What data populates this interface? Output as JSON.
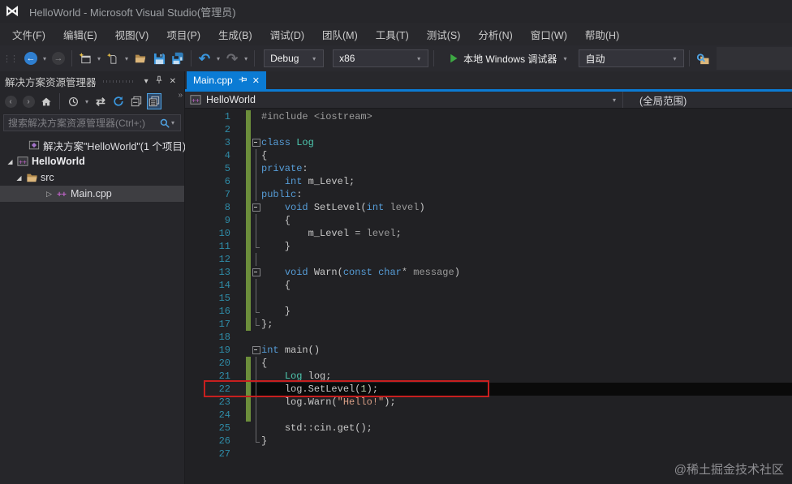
{
  "window": {
    "title": "HelloWorld - Microsoft Visual Studio(管理员)"
  },
  "menubar": {
    "items": [
      "文件(F)",
      "编辑(E)",
      "视图(V)",
      "项目(P)",
      "生成(B)",
      "调试(D)",
      "团队(M)",
      "工具(T)",
      "测试(S)",
      "分析(N)",
      "窗口(W)",
      "帮助(H)"
    ]
  },
  "toolbar": {
    "debug_combo": "Debug",
    "platform_combo": "x86",
    "run_button": "本地 Windows 调试器",
    "auto_combo": "自动"
  },
  "sidebar": {
    "title": "解决方案资源管理器",
    "search_placeholder": "搜索解决方案资源管理器(Ctrl+;)",
    "tree": [
      {
        "label": "解决方案\"HelloWorld\"(1 个项目)",
        "icon": "solution",
        "expander": "",
        "indent": 20,
        "bold": false,
        "selected": false
      },
      {
        "label": "HelloWorld",
        "icon": "cpp-project",
        "expander": "expanded",
        "indent": 6,
        "bold": true,
        "selected": false
      },
      {
        "label": "src",
        "icon": "folder-open",
        "expander": "expanded",
        "indent": 17,
        "bold": false,
        "selected": false
      },
      {
        "label": "Main.cpp",
        "icon": "cpp-file",
        "expander": "collapsed",
        "indent": 54,
        "bold": false,
        "selected": true
      }
    ]
  },
  "editor": {
    "tab": "Main.cpp",
    "navbar_project": "HelloWorld",
    "navbar_scope": "(全局范围)",
    "current_line": 22,
    "annotation_line": 22,
    "lines": [
      {
        "n": 1,
        "fold": "",
        "changed": true,
        "tokens": [
          [
            "pp",
            "#include "
          ],
          [
            "pp",
            "<iostream>"
          ]
        ]
      },
      {
        "n": 2,
        "fold": "",
        "changed": true,
        "tokens": []
      },
      {
        "n": 3,
        "fold": "start",
        "changed": true,
        "tokens": [
          [
            "kw",
            "class"
          ],
          [
            "pl",
            " "
          ],
          [
            "ty",
            "Log"
          ]
        ]
      },
      {
        "n": 4,
        "fold": "mid",
        "changed": true,
        "tokens": [
          [
            "pl",
            "{"
          ]
        ]
      },
      {
        "n": 5,
        "fold": "mid",
        "changed": true,
        "tokens": [
          [
            "kw",
            "private"
          ],
          [
            "pl",
            ":"
          ]
        ]
      },
      {
        "n": 6,
        "fold": "mid",
        "changed": true,
        "tokens": [
          [
            "pl",
            "    "
          ],
          [
            "kw",
            "int"
          ],
          [
            "pl",
            " "
          ],
          [
            "id",
            "m_Level"
          ],
          [
            "pl",
            ";"
          ]
        ]
      },
      {
        "n": 7,
        "fold": "mid",
        "changed": true,
        "tokens": [
          [
            "kw",
            "public"
          ],
          [
            "pl",
            ":"
          ]
        ]
      },
      {
        "n": 8,
        "fold": "start",
        "changed": true,
        "tokens": [
          [
            "pl",
            "    "
          ],
          [
            "kw",
            "void"
          ],
          [
            "pl",
            " "
          ],
          [
            "id",
            "SetLevel"
          ],
          [
            "pl",
            "("
          ],
          [
            "kw",
            "int"
          ],
          [
            "pl",
            " "
          ],
          [
            "pr",
            "level"
          ],
          [
            "pl",
            ")"
          ]
        ]
      },
      {
        "n": 9,
        "fold": "mid",
        "changed": true,
        "tokens": [
          [
            "pl",
            "    {"
          ]
        ]
      },
      {
        "n": 10,
        "fold": "mid",
        "changed": true,
        "tokens": [
          [
            "pl",
            "        "
          ],
          [
            "id",
            "m_Level"
          ],
          [
            "pl",
            " "
          ],
          [
            "op",
            "="
          ],
          [
            "pl",
            " "
          ],
          [
            "pr",
            "level"
          ],
          [
            "pl",
            ";"
          ]
        ]
      },
      {
        "n": 11,
        "fold": "end",
        "changed": true,
        "tokens": [
          [
            "pl",
            "    }"
          ]
        ]
      },
      {
        "n": 12,
        "fold": "mid",
        "changed": true,
        "tokens": []
      },
      {
        "n": 13,
        "fold": "start",
        "changed": true,
        "tokens": [
          [
            "pl",
            "    "
          ],
          [
            "kw",
            "void"
          ],
          [
            "pl",
            " "
          ],
          [
            "id",
            "Warn"
          ],
          [
            "pl",
            "("
          ],
          [
            "kw",
            "const"
          ],
          [
            "pl",
            " "
          ],
          [
            "kw",
            "char"
          ],
          [
            "op",
            "*"
          ],
          [
            "pl",
            " "
          ],
          [
            "pr",
            "message"
          ],
          [
            "pl",
            ")"
          ]
        ]
      },
      {
        "n": 14,
        "fold": "mid",
        "changed": true,
        "tokens": [
          [
            "pl",
            "    {"
          ]
        ]
      },
      {
        "n": 15,
        "fold": "mid",
        "changed": true,
        "tokens": []
      },
      {
        "n": 16,
        "fold": "end",
        "changed": true,
        "tokens": [
          [
            "pl",
            "    }"
          ]
        ]
      },
      {
        "n": 17,
        "fold": "end",
        "changed": true,
        "tokens": [
          [
            "pl",
            "};"
          ]
        ]
      },
      {
        "n": 18,
        "fold": "",
        "changed": false,
        "tokens": []
      },
      {
        "n": 19,
        "fold": "start",
        "changed": false,
        "tokens": [
          [
            "kw",
            "int"
          ],
          [
            "pl",
            " "
          ],
          [
            "id",
            "main"
          ],
          [
            "pl",
            "()"
          ]
        ]
      },
      {
        "n": 20,
        "fold": "mid",
        "changed": true,
        "tokens": [
          [
            "pl",
            "{"
          ]
        ]
      },
      {
        "n": 21,
        "fold": "mid",
        "changed": true,
        "tokens": [
          [
            "pl",
            "    "
          ],
          [
            "ty",
            "Log"
          ],
          [
            "pl",
            " "
          ],
          [
            "id",
            "log"
          ],
          [
            "pl",
            ";"
          ]
        ]
      },
      {
        "n": 22,
        "fold": "mid",
        "changed": true,
        "tokens": [
          [
            "pl",
            "    "
          ],
          [
            "id",
            "log"
          ],
          [
            "pl",
            "."
          ],
          [
            "id",
            "SetLevel"
          ],
          [
            "pl",
            "("
          ],
          [
            "num",
            "1"
          ],
          [
            "pl",
            ");"
          ]
        ]
      },
      {
        "n": 23,
        "fold": "mid",
        "changed": true,
        "tokens": [
          [
            "pl",
            "    "
          ],
          [
            "id",
            "log"
          ],
          [
            "pl",
            "."
          ],
          [
            "id",
            "Warn"
          ],
          [
            "pl",
            "("
          ],
          [
            "str",
            "\"Hello!\""
          ],
          [
            "pl",
            ");"
          ]
        ]
      },
      {
        "n": 24,
        "fold": "mid",
        "changed": true,
        "tokens": []
      },
      {
        "n": 25,
        "fold": "mid",
        "changed": false,
        "tokens": [
          [
            "pl",
            "    "
          ],
          [
            "id",
            "std"
          ],
          [
            "pl",
            "::"
          ],
          [
            "id",
            "cin"
          ],
          [
            "pl",
            "."
          ],
          [
            "id",
            "get"
          ],
          [
            "pl",
            "();"
          ]
        ]
      },
      {
        "n": 26,
        "fold": "end",
        "changed": false,
        "tokens": [
          [
            "pl",
            "}"
          ]
        ]
      },
      {
        "n": 27,
        "fold": "",
        "changed": false,
        "tokens": []
      }
    ]
  },
  "watermark": "@稀土掘金技术社区"
}
